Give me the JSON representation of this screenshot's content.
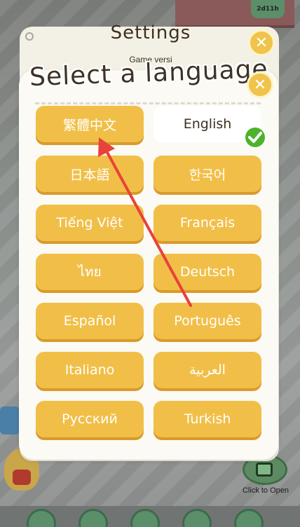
{
  "background": {
    "badge_text": "2d11h",
    "open_button_label": "Click to Open"
  },
  "settings": {
    "title": "Settings",
    "version_text": "Game versi",
    "close_symbol": "✕"
  },
  "language_dialog": {
    "title": "Select a language",
    "close_symbol": "✕",
    "selected": "English",
    "languages": [
      {
        "label": "繁體中文"
      },
      {
        "label": "English"
      },
      {
        "label": "日本語"
      },
      {
        "label": "한국어"
      },
      {
        "label": "Tiếng Việt"
      },
      {
        "label": "Français"
      },
      {
        "label": "ไทย"
      },
      {
        "label": "Deutsch"
      },
      {
        "label": "Español"
      },
      {
        "label": "Português"
      },
      {
        "label": "Italiano"
      },
      {
        "label": "العربية"
      },
      {
        "label": "Русский"
      },
      {
        "label": "Turkish"
      }
    ]
  },
  "colors": {
    "button": "#f1bf48",
    "button_shadow": "#d99a2b",
    "panel": "#fbfaf4",
    "check": "#4cb32a",
    "arrow": "#e8423a"
  },
  "icons": {
    "check": "check-icon",
    "close": "close-icon",
    "annotation": "arrow-icon"
  }
}
